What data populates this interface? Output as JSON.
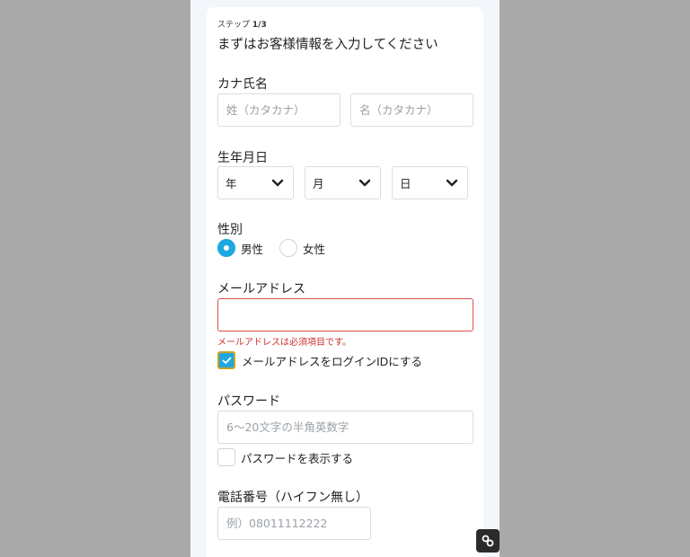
{
  "header": {
    "step_label": "ステップ",
    "step_value": "1/3",
    "title": "まずはお客様情報を入力してください"
  },
  "kana_name": {
    "label": "カナ氏名",
    "last_placeholder": "姓（カタカナ）",
    "first_placeholder": "名（カタカナ）"
  },
  "birthday": {
    "label": "生年月日",
    "year": "年",
    "month": "月",
    "day": "日"
  },
  "gender": {
    "label": "性別",
    "options": [
      "男性",
      "女性"
    ],
    "selected": "男性"
  },
  "email": {
    "label": "メールアドレス",
    "value": "",
    "error": "メールアドレスは必須項目です。",
    "login_id_checkbox_label": "メールアドレスをログインIDにする",
    "login_id_checked": true
  },
  "password": {
    "label": "パスワード",
    "placeholder": "6〜20文字の半角英数字",
    "show_checkbox_label": "パスワードを表示する",
    "show_checked": false
  },
  "phone": {
    "label": "電話番号（ハイフン無し）",
    "placeholder": "例）08011112222"
  },
  "colors": {
    "accent": "#1ea7e1",
    "error": "#c9302c",
    "focus_ring": "#c9a227"
  },
  "icons": {
    "select_arrow": "chevron-down-icon",
    "checkbox_check": "check-icon",
    "floating_button": "link-icon"
  }
}
